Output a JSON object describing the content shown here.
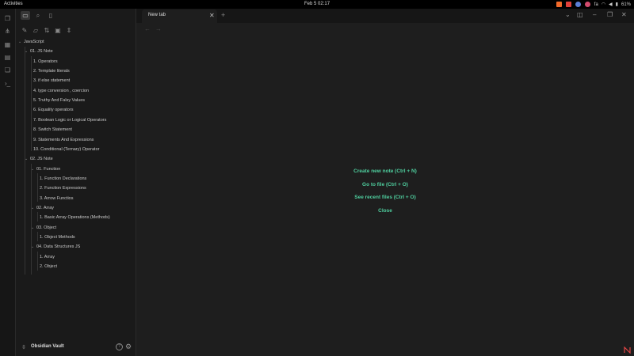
{
  "topbar": {
    "activities": "Activities",
    "clock": "Feb 5  02:17",
    "tray_apps": [
      {
        "icon": "brave-icon",
        "color": "#f26a2a"
      },
      {
        "icon": "app-red-icon",
        "color": "#e0403a"
      },
      {
        "icon": "chrome-icon",
        "color": "#5b7fd6"
      },
      {
        "icon": "firefox-icon",
        "color": "#d24b6e"
      }
    ],
    "input_method": "fa",
    "battery": "61%"
  },
  "ribbon": [
    "files-icon",
    "graph-icon",
    "canvas-icon",
    "calendar-icon",
    "templates-icon",
    "terminal-icon"
  ],
  "sidebar": {
    "tree": [
      {
        "label": "JavaScript",
        "depth": 0,
        "chevron": true
      },
      {
        "label": "01. JS Note",
        "depth": 1,
        "chevron": true
      },
      {
        "label": "1. Operators",
        "depth": 2,
        "chevron": false
      },
      {
        "label": "2. Template literals",
        "depth": 2,
        "chevron": false
      },
      {
        "label": "3. if else statement",
        "depth": 2,
        "chevron": false
      },
      {
        "label": "4. type conversion , coercion",
        "depth": 2,
        "chevron": false
      },
      {
        "label": "5. Truthy And Falsy Values",
        "depth": 2,
        "chevron": false
      },
      {
        "label": "6. Equality operators",
        "depth": 2,
        "chevron": false
      },
      {
        "label": "7. Boolean Logic or Logical Operators",
        "depth": 2,
        "chevron": false
      },
      {
        "label": "8. Switch Statement",
        "depth": 2,
        "chevron": false
      },
      {
        "label": "9. Statements And Expressions",
        "depth": 2,
        "chevron": false
      },
      {
        "label": "10. Conditional (Ternary) Operator",
        "depth": 2,
        "chevron": false
      },
      {
        "label": "02. JS Note",
        "depth": 1,
        "chevron": true
      },
      {
        "label": "01. Function",
        "depth": 2,
        "chevron": true
      },
      {
        "label": "1. Function Declarations",
        "depth": 3,
        "chevron": false
      },
      {
        "label": "2. Function Expressions",
        "depth": 3,
        "chevron": false
      },
      {
        "label": "3. Arrow Functios",
        "depth": 3,
        "chevron": false
      },
      {
        "label": "02. Array",
        "depth": 2,
        "chevron": true
      },
      {
        "label": "1. Basic Array Operations (Methods)",
        "depth": 3,
        "chevron": false
      },
      {
        "label": "03. Object",
        "depth": 2,
        "chevron": true
      },
      {
        "label": "1. Object Methods",
        "depth": 3,
        "chevron": false
      },
      {
        "label": "04. Data Structures JS",
        "depth": 2,
        "chevron": true
      },
      {
        "label": "1. Array",
        "depth": 3,
        "chevron": false
      },
      {
        "label": "2. Object",
        "depth": 3,
        "chevron": false
      }
    ],
    "vault_name": "Obsidian Vault"
  },
  "main": {
    "tab_label": "New tab",
    "actions": [
      "Create new note (Ctrl + N)",
      "Go to file (Ctrl + O)",
      "See recent files (Ctrl + O)",
      "Close"
    ],
    "accent": "#4fcf9f"
  }
}
